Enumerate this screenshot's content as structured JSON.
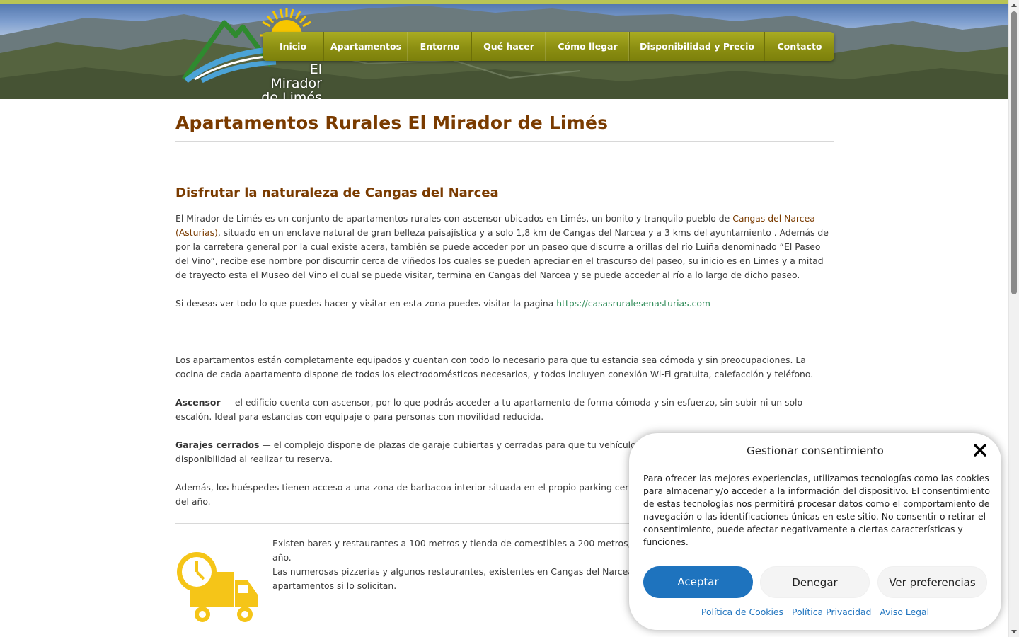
{
  "header": {
    "logo_line1": "El Mirador",
    "logo_line2": "de Limés"
  },
  "nav": {
    "items": [
      "Inicio",
      "Apartamentos",
      "Entorno",
      "Qué hacer",
      "Cómo llegar",
      "Disponibilidad y Precio",
      "Contacto"
    ]
  },
  "main": {
    "title": "Apartamentos Rurales El Mirador de Limés",
    "subtitle": "Disfrutar la naturaleza de Cangas del Narcea",
    "intro_before_link": "El Mirador de Limés es un conjunto de apartamentos rurales con ascensor ubicados en Limés, un bonito y tranquilo pueblo de ",
    "intro_link": "Cangas del Narcea (Asturias)",
    "intro_after_link": ", situado  en un enclave natural de gran belleza paisajística y a solo 1,8 km de Cangas del Narcea y a 3 kms del ayuntamiento .  Además de por la carretera general por la cual existe acera, también se puede acceder por un paseo que discurre a orillas del río Luiña denominado “El Paseo del Vino”, recibe ese  nombre por discurrir cerca de viñedos los cuales se pueden apreciar en el trascurso del paseo, su inicio es en Limes y a mitad de trayecto esta el Museo del Vino el cual se puede visitar,  termina en Cangas del Narcea y se puede acceder al río a lo largo de dicho paseo.",
    "visit_text": "Si deseas ver todo lo que puedes hacer y visitar en esta zona puedes visitar la pagina ",
    "visit_link": "https://casasruralesenasturias.com",
    "equipped_text": "Los apartamentos están completamente equipados y cuentan con todo lo necesario para que tu estancia sea cómoda y sin preocupaciones. La cocina de cada apartamento dispone de todos los electrodomésticos necesarios, y todos incluyen conexión Wi-Fi gratuita, calefacción y teléfono.",
    "elevator_label": "Ascensor",
    "elevator_text": " — el edificio cuenta con ascensor, por lo que podrás acceder a tu apartamento de forma cómoda y sin esfuerzo, sin subir ni un solo escalón. Ideal para estancias con equipaje o para personas con movilidad reducida.",
    "garage_label": "Garajes cerrados",
    "garage_text": " — el complejo dispone de plazas de garaje cubiertas y cerradas para que tu vehículo esté",
    "garage_text2": "disponibilidad al realizar tu reserva.",
    "bbq_text": "Además, los huéspedes tienen acceso a una zona de barbacoa interior situada en el propio parking cerrado",
    "bbq_text2": "del año.",
    "service_line1": "Existen bares y restaurantes a 100 metros y tienda de comestibles a 200 metros, ab",
    "service_line2": "año.",
    "service_line3": "Las numerosas pizzerías y algunos restaurantes, existentes en Cangas del Narcea le",
    "service_line4": "apartamentos si lo solicitan."
  },
  "consent": {
    "title": "Gestionar consentimiento",
    "text": "Para ofrecer las mejores experiencias, utilizamos tecnologías como las cookies para almacenar y/o acceder a la información del dispositivo. El consentimiento de estas tecnologías nos permitirá procesar datos como el comportamiento de navegación o las identificaciones únicas en este sitio. No consentir o retirar el consentimiento, puede afectar negativamente a ciertas características y funciones.",
    "accept": "Aceptar",
    "deny": "Denegar",
    "preferences": "Ver preferencias",
    "links": [
      "Política de Cookies",
      "Política Privacidad",
      "Aviso Legal"
    ]
  },
  "colors": {
    "heading": "#7a3b00",
    "nav": "#8c8f12",
    "accept_button": "#1e73be",
    "link_green": "#2e8b57",
    "truck": "#f5c518"
  },
  "icons": [
    "close-icon",
    "delivery-truck-clock-icon",
    "sun-mountain-logo"
  ]
}
